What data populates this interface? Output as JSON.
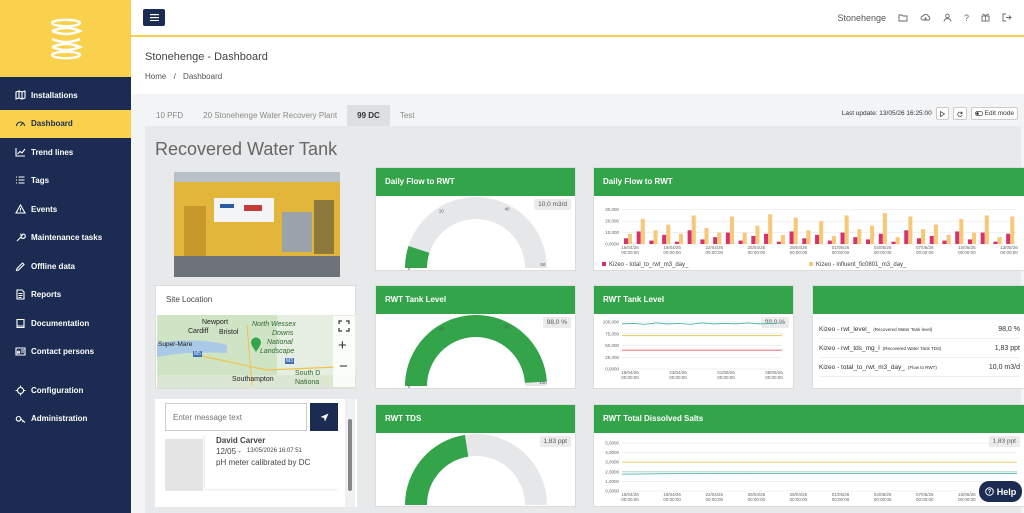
{
  "nav": [
    {
      "label": "Installations",
      "icon": "map-icon"
    },
    {
      "label": "Dashboard",
      "icon": "dashboard-icon",
      "active": true
    },
    {
      "label": "Trend lines",
      "icon": "chart-icon"
    },
    {
      "label": "Tags",
      "icon": "list-icon"
    },
    {
      "label": "Events",
      "icon": "warning-icon"
    },
    {
      "label": "Maintenance tasks",
      "icon": "wrench-icon"
    },
    {
      "label": "Offline data",
      "icon": "pencil-icon"
    },
    {
      "label": "Reports",
      "icon": "report-icon"
    },
    {
      "label": "Documentation",
      "icon": "book-icon"
    },
    {
      "label": "Contact persons",
      "icon": "contact-icon"
    },
    {
      "label": "Configuration",
      "icon": "gear-icon"
    },
    {
      "label": "Administration",
      "icon": "key-icon"
    }
  ],
  "topbar": {
    "installation": "Stonehenge"
  },
  "page": {
    "heading": "Stonehenge - Dashboard",
    "crumb_home": "Home",
    "crumb_sep": "/",
    "crumb_current": "Dashboard"
  },
  "tabs": [
    {
      "label": "10 PFD"
    },
    {
      "label": "20 Stonehenge Water Recovery Plant"
    },
    {
      "label": "99 DC",
      "active": true
    },
    {
      "label": "Test"
    }
  ],
  "update": {
    "label": "Last update: 13/05/26 16:25:00",
    "edit": "Edit mode"
  },
  "dashboard": {
    "title": "Recovered Water Tank"
  },
  "site": {
    "title": "Site Location",
    "map_labels": [
      "Newport",
      "Cardiff",
      "Bristol",
      "North Wessex",
      "Downs",
      "National",
      "Landscape",
      "Super-Mare",
      "M5",
      "M3",
      "South D",
      "Nationa",
      "Southampton"
    ]
  },
  "chat": {
    "placeholder": "Enter message text",
    "author": "David Carver",
    "date_short": "12/05 -",
    "datetime": "13/05/2026 16:07:51",
    "message": "pH meter calibrated by DC"
  },
  "gauges": {
    "flow": {
      "title": "Daily Flow to RWT",
      "badge": "10,0 m3/d",
      "value": 0.1,
      "ticks": [
        "0",
        "10",
        "40",
        "50"
      ]
    },
    "level": {
      "title": "RWT Tank Level",
      "badge": "98,0 %",
      "value": 0.98,
      "ticks": [
        "0",
        "40",
        "80",
        "100"
      ]
    },
    "tds": {
      "title": "RWT TDS",
      "badge": "1,83 ppt",
      "value": 0.45,
      "ticks": []
    }
  },
  "chart_data": [
    {
      "type": "bar",
      "title": "Daily Flow to RWT",
      "yticks": [
        "0,0000",
        "10,000",
        "20,000",
        "30,000"
      ],
      "ylim": [
        0,
        35000
      ],
      "xticks": [
        "16/04/26\n00:00:00",
        "19/04/26\n00:00:00",
        "22/04/26\n00:00:00",
        "25/04/26\n00:00:00",
        "28/04/26\n00:00:00",
        "01/05/26\n00:00:00",
        "04/05/26\n00:00:00",
        "07/05/26\n00:00:00",
        "10/05/26\n00:00:00",
        "13/05/26\n00:00:00"
      ],
      "series": [
        {
          "name": "Kizeo - total_to_rwt_m3_day_",
          "color": "#d6336c",
          "values": [
            5000,
            11000,
            3000,
            8000,
            2000,
            12000,
            4000,
            6000,
            10000,
            3000,
            7000,
            9000,
            2000,
            11000,
            5000,
            8000,
            3000,
            10000,
            6000,
            4000,
            9000,
            2000,
            12000,
            5000,
            7000,
            3000,
            11000,
            4000,
            10000,
            2000,
            9000
          ]
        },
        {
          "name": "Kizeo - influent_fic0801_m3_day_",
          "color": "#f7c879",
          "values": [
            9000,
            22000,
            12000,
            17000,
            9000,
            25000,
            14000,
            10000,
            24000,
            10000,
            16000,
            26000,
            8000,
            23000,
            12000,
            20000,
            7000,
            25000,
            13000,
            16000,
            27000,
            6000,
            24000,
            13000,
            17000,
            8000,
            22000,
            10000,
            25000,
            6000,
            24000
          ]
        }
      ]
    },
    {
      "type": "line",
      "title": "RWT Tank Level",
      "badge": "98,0 %",
      "yticks": [
        "0,0000",
        "25,000",
        "50,000",
        "75,000",
        "100,000"
      ],
      "ylim": [
        0,
        100000
      ],
      "xticks": [
        "16/04/26\n00:00:00",
        "23/04/26\n00:00:00",
        "01/05/26\n00:00:00",
        "08/05/26\n00:00:00"
      ],
      "series": [
        {
          "color": "#4fb4a5",
          "values": [
            96000,
            97000,
            95000,
            98000,
            96000,
            97000,
            95000,
            98000,
            96000,
            97000,
            96000,
            98000,
            96000,
            97000,
            98000
          ]
        },
        {
          "color": "#f3c35a",
          "values": [
            71000,
            71000,
            71000,
            71000,
            71000,
            71000,
            71000,
            71000,
            71000,
            71000,
            71000,
            71000,
            71000,
            71000,
            71000
          ]
        },
        {
          "color": "#e05c5c",
          "values": [
            40000,
            40000,
            40000,
            40000,
            40000,
            40000,
            40000,
            40000,
            40000,
            40000,
            40000,
            40000,
            40000,
            40000,
            40000
          ]
        }
      ]
    },
    {
      "type": "line",
      "title": "RWT Total Dissolved Salts",
      "badge": "1,83 ppt",
      "yticks": [
        "0,0000",
        "1,0000",
        "2,0000",
        "3,0000",
        "4,0000",
        "5,0000"
      ],
      "ylim": [
        0,
        5000
      ],
      "xticks": [
        "16/04/26\n00:00:00",
        "19/04/26\n00:00:00",
        "22/04/26\n00:00:00",
        "25/04/26\n00:00:00",
        "28/04/26\n00:00:00",
        "01/05/26\n00:00:00",
        "04/05/26\n00:00:00",
        "07/05/26\n00:00:00",
        "10/05/26\n00:00:00",
        "13/05/26\n00:00:00"
      ],
      "series": [
        {
          "color": "#f3c35a",
          "values": [
            3000,
            3000,
            3000,
            3000,
            3000,
            3000,
            3000,
            3000,
            3000,
            3000
          ]
        },
        {
          "color": "#9fc8c8",
          "values": [
            2000,
            2000,
            2000,
            2000,
            2000,
            2000,
            2000,
            2000,
            2000,
            2000
          ]
        },
        {
          "color": "#4fb4a5",
          "values": [
            1750,
            1800,
            1820,
            1830,
            1830,
            1830,
            1830,
            1830,
            1830,
            1830
          ]
        }
      ]
    }
  ],
  "table": {
    "rows": [
      {
        "name": "Kizeo - rwt_level_",
        "note": "(Recovered Water Tank level)",
        "value": "98,0 %"
      },
      {
        "name": "Kizeo - rwt_tds_mg_l",
        "note": "(Recovered Water Tank TDS)",
        "value": "1,83 ppt"
      },
      {
        "name": "Kizeo - total_to_rwt_m3_day_",
        "note": "(Flow to RWT)",
        "value": "10,0 m3/d"
      }
    ]
  },
  "help": {
    "label": "Help"
  },
  "colors": {
    "green": "#34a44a",
    "navy": "#1b2b52",
    "yellow": "#f9d14c"
  }
}
